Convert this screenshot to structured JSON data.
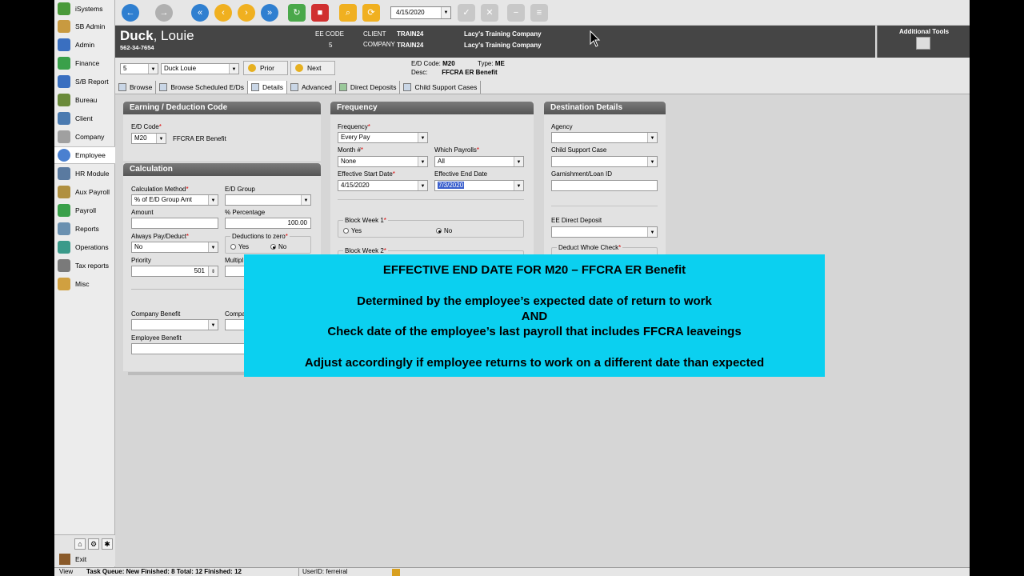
{
  "sidebar": {
    "items": [
      {
        "label": "iSystems",
        "icon": "isystems-icon",
        "color": "#4a9a3a"
      },
      {
        "label": "SB Admin",
        "icon": "sb-admin-icon",
        "color": "#c89a40"
      },
      {
        "label": "Admin",
        "icon": "admin-icon",
        "color": "#3a6fc0"
      },
      {
        "label": "Finance",
        "icon": "finance-icon",
        "color": "#3aa04a"
      },
      {
        "label": "S/B Report",
        "icon": "sb-report-icon",
        "color": "#3a6fc0"
      },
      {
        "label": "Bureau",
        "icon": "bureau-icon",
        "color": "#6a8a3a"
      },
      {
        "label": "Client",
        "icon": "client-icon",
        "color": "#4a7ab0"
      },
      {
        "label": "Company",
        "icon": "company-icon",
        "color": "#a0a0a0"
      },
      {
        "label": "Employee",
        "icon": "employee-icon",
        "color": "#4a80d0"
      },
      {
        "label": "HR Module",
        "icon": "hr-module-icon",
        "color": "#5a7aa0"
      },
      {
        "label": "Aux Payroll",
        "icon": "aux-payroll-icon",
        "color": "#b09040"
      },
      {
        "label": "Payroll",
        "icon": "payroll-icon",
        "color": "#3aa04a"
      },
      {
        "label": "Reports",
        "icon": "reports-icon",
        "color": "#6a90b0"
      },
      {
        "label": "Operations",
        "icon": "operations-icon",
        "color": "#3a9a8a"
      },
      {
        "label": "Tax reports",
        "icon": "tax-reports-icon",
        "color": "#7a7a7a"
      },
      {
        "label": "Misc",
        "icon": "misc-icon",
        "color": "#d0a040"
      }
    ],
    "exit_label": "Exit"
  },
  "toolbar": {
    "date": "4/15/2020"
  },
  "header": {
    "last_name": "Duck",
    "first_name": ", Louie",
    "ssn": "562-34-7654",
    "ee_code_label": "EE CODE",
    "ee_code": "5",
    "client_label": "CLIENT",
    "client_code": "TRAIN24",
    "company_label": "COMPANY",
    "company_code": "TRAIN24",
    "client_name": "Lacy's Training Company",
    "company_name": "Lacy's Training Company",
    "additional_tools": "Additional Tools"
  },
  "nav": {
    "ee_number": "5",
    "ee_name": "Duck Louie",
    "prior_label": "Prior",
    "next_label": "Next",
    "ed_code_label": "E/D Code:",
    "ed_code": "M20",
    "type_label": "Type:",
    "type": "ME",
    "desc_label": "Desc:",
    "desc": "FFCRA ER Benefit"
  },
  "tabs": [
    "Browse",
    "Browse Scheduled E/Ds",
    "Details",
    "Advanced",
    "Direct Deposits",
    "Child Support Cases"
  ],
  "earning": {
    "title": "Earning / Deduction Code",
    "ed_code_label": "E/D Code",
    "ed_code": "M20",
    "ed_desc": "FFCRA ER Benefit"
  },
  "calculation": {
    "title": "Calculation",
    "method_label": "Calculation Method",
    "method": "% of E/D Group Amt",
    "ed_group_label": "E/D Group",
    "ed_group": "",
    "amount_label": "Amount",
    "amount": "",
    "percentage_label": "% Percentage",
    "percentage": "100.00",
    "always_pay_label": "Always Pay/Deduct",
    "always_pay": "No",
    "deductions_zero_label": "Deductions to zero",
    "yes_label": "Yes",
    "no_label": "No",
    "priority_label": "Priority",
    "priority": "501",
    "multiplier_label": "Multipl",
    "company_benefit_label": "Company Benefit",
    "company_label_cut": "Compa",
    "employee_benefit_label": "Employee Benefit"
  },
  "frequency": {
    "title": "Frequency",
    "frequency_label": "Frequency",
    "frequency": "Every Pay",
    "month_label": "Month #",
    "month": "None",
    "which_payrolls_label": "Which Payrolls",
    "which_payrolls": "All",
    "start_label": "Effective Start Date",
    "start_date": "4/15/2020",
    "end_label": "Effective End Date",
    "end_date": "7/3/2020",
    "block_week1_label": "Block Week 1",
    "yes_label": "Yes",
    "no_label": "No",
    "block_week2_label": "Block Week 2"
  },
  "destination": {
    "title": "Destination Details",
    "agency_label": "Agency",
    "child_support_label": "Child Support Case",
    "garnishment_label": "Garnishment/Loan ID",
    "ee_dd_label": "EE Direct Deposit",
    "deduct_whole_label": "Deduct Whole Check"
  },
  "overlay": {
    "color": "#0bd0f0",
    "line1": "EFFECTIVE END DATE FOR M20 – FFCRA ER Benefit",
    "line2": "Determined by the employee’s expected date of return to work",
    "line3": "AND",
    "line4": "Check date of the employee’s last payroll that includes FFCRA leaveings",
    "line5": "Adjust accordingly if employee returns to work on a different date than expected"
  },
  "status": {
    "view": "View",
    "task_queue": "Task Queue:  New Finished: 8  Total: 12  Finished: 12",
    "user": "UserID: ferreiral"
  }
}
